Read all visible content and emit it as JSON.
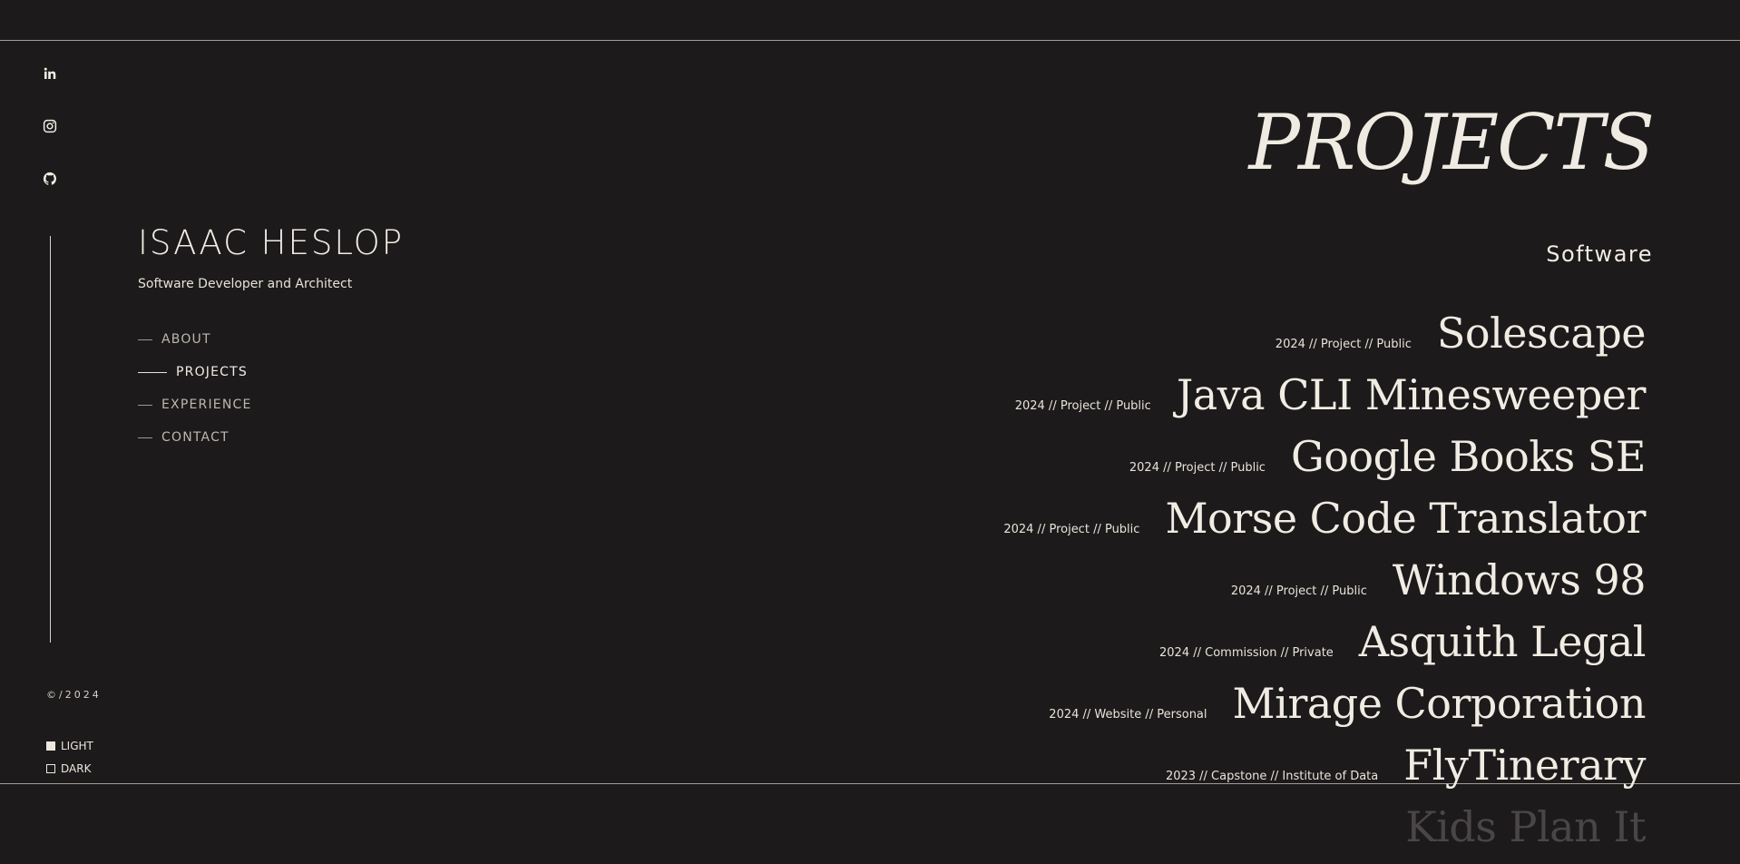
{
  "profile": {
    "name": "ISAAC HESLOP",
    "tagline": "Software Developer and Architect"
  },
  "socials": [
    {
      "icon": "linkedin-icon"
    },
    {
      "icon": "instagram-icon"
    },
    {
      "icon": "github-icon"
    }
  ],
  "nav": [
    {
      "label": "ABOUT",
      "active": false
    },
    {
      "label": "PROJECTS",
      "active": true
    },
    {
      "label": "EXPERIENCE",
      "active": false
    },
    {
      "label": "CONTACT",
      "active": false
    }
  ],
  "footer": {
    "copyright": "©/2024",
    "theme_light": "LIGHT",
    "theme_dark": "DARK",
    "selected_theme": "LIGHT"
  },
  "main": {
    "title": "PROJECTS",
    "section": "Software",
    "projects": [
      {
        "meta": "2024 // Project // Public",
        "name": "Solescape"
      },
      {
        "meta": "2024 // Project // Public",
        "name": "Java CLI Minesweeper"
      },
      {
        "meta": "2024 // Project // Public",
        "name": "Google Books SE"
      },
      {
        "meta": "2024 // Project // Public",
        "name": "Morse Code Translator"
      },
      {
        "meta": "2024 // Project // Public",
        "name": "Windows 98"
      },
      {
        "meta": "2024 // Commission // Private",
        "name": "Asquith Legal"
      },
      {
        "meta": "2024 // Website // Personal",
        "name": "Mirage Corporation"
      },
      {
        "meta": "2023 // Capstone // Institute of Data",
        "name": "FlyTinerary"
      },
      {
        "meta": "",
        "name": "Kids Plan It"
      }
    ]
  },
  "colors": {
    "background": "#1c1a1b",
    "text": "#efe9df"
  }
}
